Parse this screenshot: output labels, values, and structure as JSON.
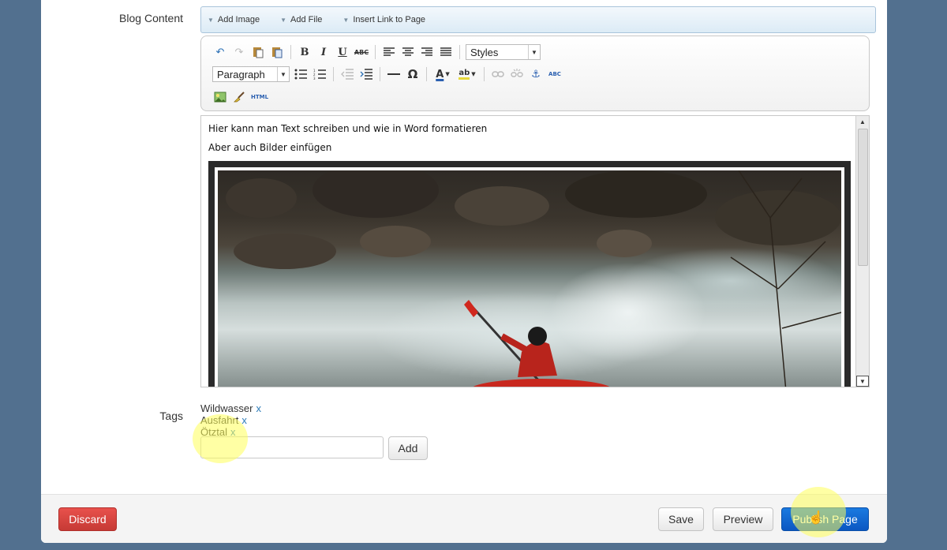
{
  "form": {
    "blog_content_label": "Blog Content",
    "tags_label": "Tags"
  },
  "attach_bar": {
    "items": [
      {
        "label": "Add Image"
      },
      {
        "label": "Add File"
      },
      {
        "label": "Insert Link to Page"
      }
    ]
  },
  "toolbar": {
    "styles_select": "Styles",
    "format_select": "Paragraph",
    "bold": "B",
    "italic": "I",
    "underline": "U",
    "strikethrough": "ABC",
    "special_char": "Ω",
    "text_color": "A",
    "highlight": "ab",
    "spellcheck": "ABC",
    "html": "HTML"
  },
  "editor": {
    "line1": "Hier kann man Text schreiben und wie in Word formatieren",
    "line2": "Aber auch Bilder einfügen",
    "image_icon": "kayak-photo"
  },
  "tags": {
    "items": [
      "Wildwasser",
      "Ausfahrt",
      "Ötztal"
    ],
    "remove_label": "x",
    "input_value": "",
    "add_button": "Add"
  },
  "footer": {
    "discard": "Discard",
    "save": "Save",
    "preview": "Preview",
    "publish": "Publish Page"
  },
  "colors": {
    "background": "#52708f",
    "discard": "#d9443f",
    "publish": "#0b63d6",
    "tag_link": "#2a7ab8",
    "click_highlight": "#ffff5a"
  }
}
